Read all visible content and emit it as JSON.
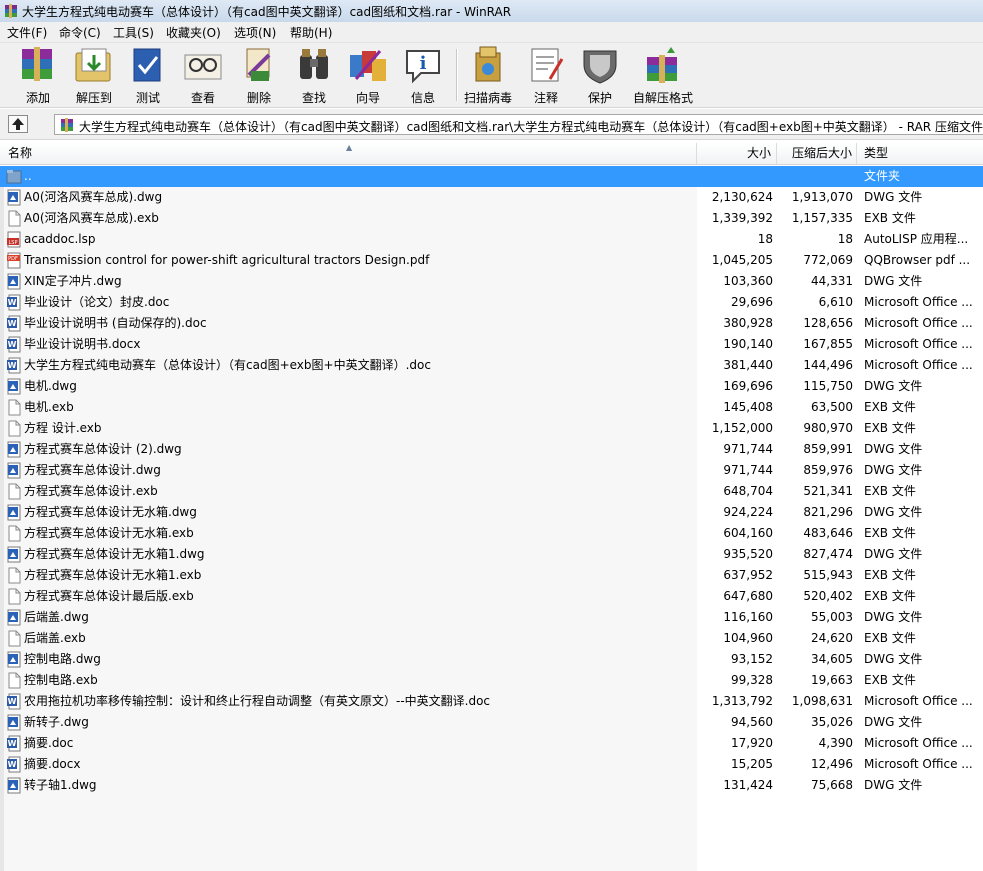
{
  "window": {
    "title": "大学生方程式纯电动赛车（总体设计）（有cad图中英文翻译）cad图纸和文档.rar - WinRAR"
  },
  "menu": [
    "文件(F)",
    "命令(C)",
    "工具(S)",
    "收藏夹(O)",
    "选项(N)",
    "帮助(H)"
  ],
  "toolbar": [
    {
      "label": "添加",
      "icon": "add-archive-icon"
    },
    {
      "label": "解压到",
      "icon": "extract-to-icon"
    },
    {
      "label": "测试",
      "icon": "test-icon"
    },
    {
      "label": "查看",
      "icon": "view-icon"
    },
    {
      "label": "删除",
      "icon": "delete-icon"
    },
    {
      "label": "查找",
      "icon": "find-icon"
    },
    {
      "label": "向导",
      "icon": "wizard-icon"
    },
    {
      "label": "信息",
      "icon": "info-icon"
    },
    {
      "label": "扫描病毒",
      "icon": "virus-scan-icon"
    },
    {
      "label": "注释",
      "icon": "comment-icon"
    },
    {
      "label": "保护",
      "icon": "protect-icon"
    },
    {
      "label": "自解压格式",
      "icon": "sfx-icon"
    }
  ],
  "address": {
    "path": "大学生方程式纯电动赛车（总体设计）（有cad图中英文翻译）cad图纸和文档.rar\\大学生方程式纯电动赛车（总体设计）（有cad图+exb图+中英文翻译） - RAR 压缩文件"
  },
  "columns": {
    "name": "名称",
    "size": "大小",
    "packed": "压缩后大小",
    "type": "类型"
  },
  "files": [
    {
      "name": "..",
      "size": "",
      "packed": "",
      "type": "文件夹",
      "icon": "folder-up"
    },
    {
      "name": "A0(河洛风赛车总成).dwg",
      "size": "2,130,624",
      "packed": "1,913,070",
      "type": "DWG 文件",
      "icon": "dwg"
    },
    {
      "name": "A0(河洛风赛车总成).exb",
      "size": "1,339,392",
      "packed": "1,157,335",
      "type": "EXB 文件",
      "icon": "blank"
    },
    {
      "name": "acaddoc.lsp",
      "size": "18",
      "packed": "18",
      "type": "AutoLISP 应用程...",
      "icon": "lsp"
    },
    {
      "name": "Transmission control for power-shift agricultural tractors Design.pdf",
      "size": "1,045,205",
      "packed": "772,069",
      "type": "QQBrowser pdf ...",
      "icon": "pdf"
    },
    {
      "name": "XIN定子冲片.dwg",
      "size": "103,360",
      "packed": "44,331",
      "type": "DWG 文件",
      "icon": "dwg"
    },
    {
      "name": "毕业设计（论文）封皮.doc",
      "size": "29,696",
      "packed": "6,610",
      "type": "Microsoft Office ...",
      "icon": "doc"
    },
    {
      "name": "毕业设计说明书 (自动保存的).doc",
      "size": "380,928",
      "packed": "128,656",
      "type": "Microsoft Office ...",
      "icon": "doc"
    },
    {
      "name": "毕业设计说明书.docx",
      "size": "190,140",
      "packed": "167,855",
      "type": "Microsoft Office ...",
      "icon": "doc"
    },
    {
      "name": "大学生方程式纯电动赛车（总体设计）（有cad图+exb图+中英文翻译）.doc",
      "size": "381,440",
      "packed": "144,496",
      "type": "Microsoft Office ...",
      "icon": "doc"
    },
    {
      "name": "电机.dwg",
      "size": "169,696",
      "packed": "115,750",
      "type": "DWG 文件",
      "icon": "dwg"
    },
    {
      "name": "电机.exb",
      "size": "145,408",
      "packed": "63,500",
      "type": "EXB 文件",
      "icon": "blank"
    },
    {
      "name": "方程 设计.exb",
      "size": "1,152,000",
      "packed": "980,970",
      "type": "EXB 文件",
      "icon": "blank"
    },
    {
      "name": "方程式赛车总体设计 (2).dwg",
      "size": "971,744",
      "packed": "859,991",
      "type": "DWG 文件",
      "icon": "dwg"
    },
    {
      "name": "方程式赛车总体设计.dwg",
      "size": "971,744",
      "packed": "859,976",
      "type": "DWG 文件",
      "icon": "dwg"
    },
    {
      "name": "方程式赛车总体设计.exb",
      "size": "648,704",
      "packed": "521,341",
      "type": "EXB 文件",
      "icon": "blank"
    },
    {
      "name": "方程式赛车总体设计无水箱.dwg",
      "size": "924,224",
      "packed": "821,296",
      "type": "DWG 文件",
      "icon": "dwg"
    },
    {
      "name": "方程式赛车总体设计无水箱.exb",
      "size": "604,160",
      "packed": "483,646",
      "type": "EXB 文件",
      "icon": "blank"
    },
    {
      "name": "方程式赛车总体设计无水箱1.dwg",
      "size": "935,520",
      "packed": "827,474",
      "type": "DWG 文件",
      "icon": "dwg"
    },
    {
      "name": "方程式赛车总体设计无水箱1.exb",
      "size": "637,952",
      "packed": "515,943",
      "type": "EXB 文件",
      "icon": "blank"
    },
    {
      "name": "方程式赛车总体设计最后版.exb",
      "size": "647,680",
      "packed": "520,402",
      "type": "EXB 文件",
      "icon": "blank"
    },
    {
      "name": "后端盖.dwg",
      "size": "116,160",
      "packed": "55,003",
      "type": "DWG 文件",
      "icon": "dwg"
    },
    {
      "name": "后端盖.exb",
      "size": "104,960",
      "packed": "24,620",
      "type": "EXB 文件",
      "icon": "blank"
    },
    {
      "name": "控制电路.dwg",
      "size": "93,152",
      "packed": "34,605",
      "type": "DWG 文件",
      "icon": "dwg"
    },
    {
      "name": "控制电路.exb",
      "size": "99,328",
      "packed": "19,663",
      "type": "EXB 文件",
      "icon": "blank"
    },
    {
      "name": "农用拖拉机功率移传输控制：设计和终止行程自动调整（有英文原文）--中英文翻译.doc",
      "size": "1,313,792",
      "packed": "1,098,631",
      "type": "Microsoft Office ...",
      "icon": "doc"
    },
    {
      "name": "新转子.dwg",
      "size": "94,560",
      "packed": "35,026",
      "type": "DWG 文件",
      "icon": "dwg"
    },
    {
      "name": "摘要.doc",
      "size": "17,920",
      "packed": "4,390",
      "type": "Microsoft Office ...",
      "icon": "doc"
    },
    {
      "name": "摘要.docx",
      "size": "15,205",
      "packed": "12,496",
      "type": "Microsoft Office ...",
      "icon": "doc"
    },
    {
      "name": "转子轴1.dwg",
      "size": "131,424",
      "packed": "75,668",
      "type": "DWG 文件",
      "icon": "dwg"
    }
  ]
}
